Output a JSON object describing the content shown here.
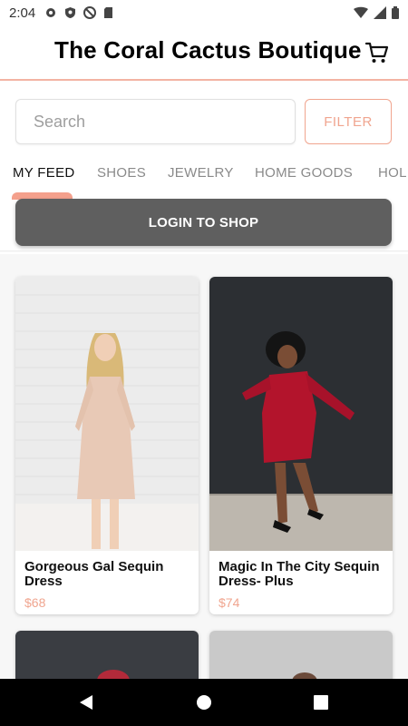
{
  "status_bar": {
    "time": "2:04",
    "left_icons": [
      "gear-icon",
      "shield-icon",
      "no-disturb-icon",
      "sim-card-icon"
    ],
    "right_icons": [
      "wifi-icon",
      "signal-icon",
      "battery-icon"
    ]
  },
  "header": {
    "title": "The Coral Cactus Boutique",
    "cart_icon": "cart-icon"
  },
  "search": {
    "placeholder": "Search",
    "value": ""
  },
  "filter": {
    "label": "FILTER"
  },
  "tabs": [
    {
      "label": "MY FEED",
      "active": true
    },
    {
      "label": "SHOES",
      "active": false
    },
    {
      "label": "JEWELRY",
      "active": false
    },
    {
      "label": "HOME GOODS",
      "active": false
    },
    {
      "label": "HOL",
      "active": false
    }
  ],
  "login": {
    "label": "LOGIN TO SHOP"
  },
  "products": [
    {
      "name": "Gorgeous Gal Sequin Dress",
      "price": "$68"
    },
    {
      "name": "Magic In The City Sequin Dress- Plus",
      "price": "$74"
    }
  ],
  "nav": {
    "icons": [
      "back-icon",
      "home-icon",
      "recents-icon"
    ]
  },
  "colors": {
    "accent": "#f4a08c",
    "price": "#f0a58f",
    "login_bg": "#5f5f5f"
  }
}
